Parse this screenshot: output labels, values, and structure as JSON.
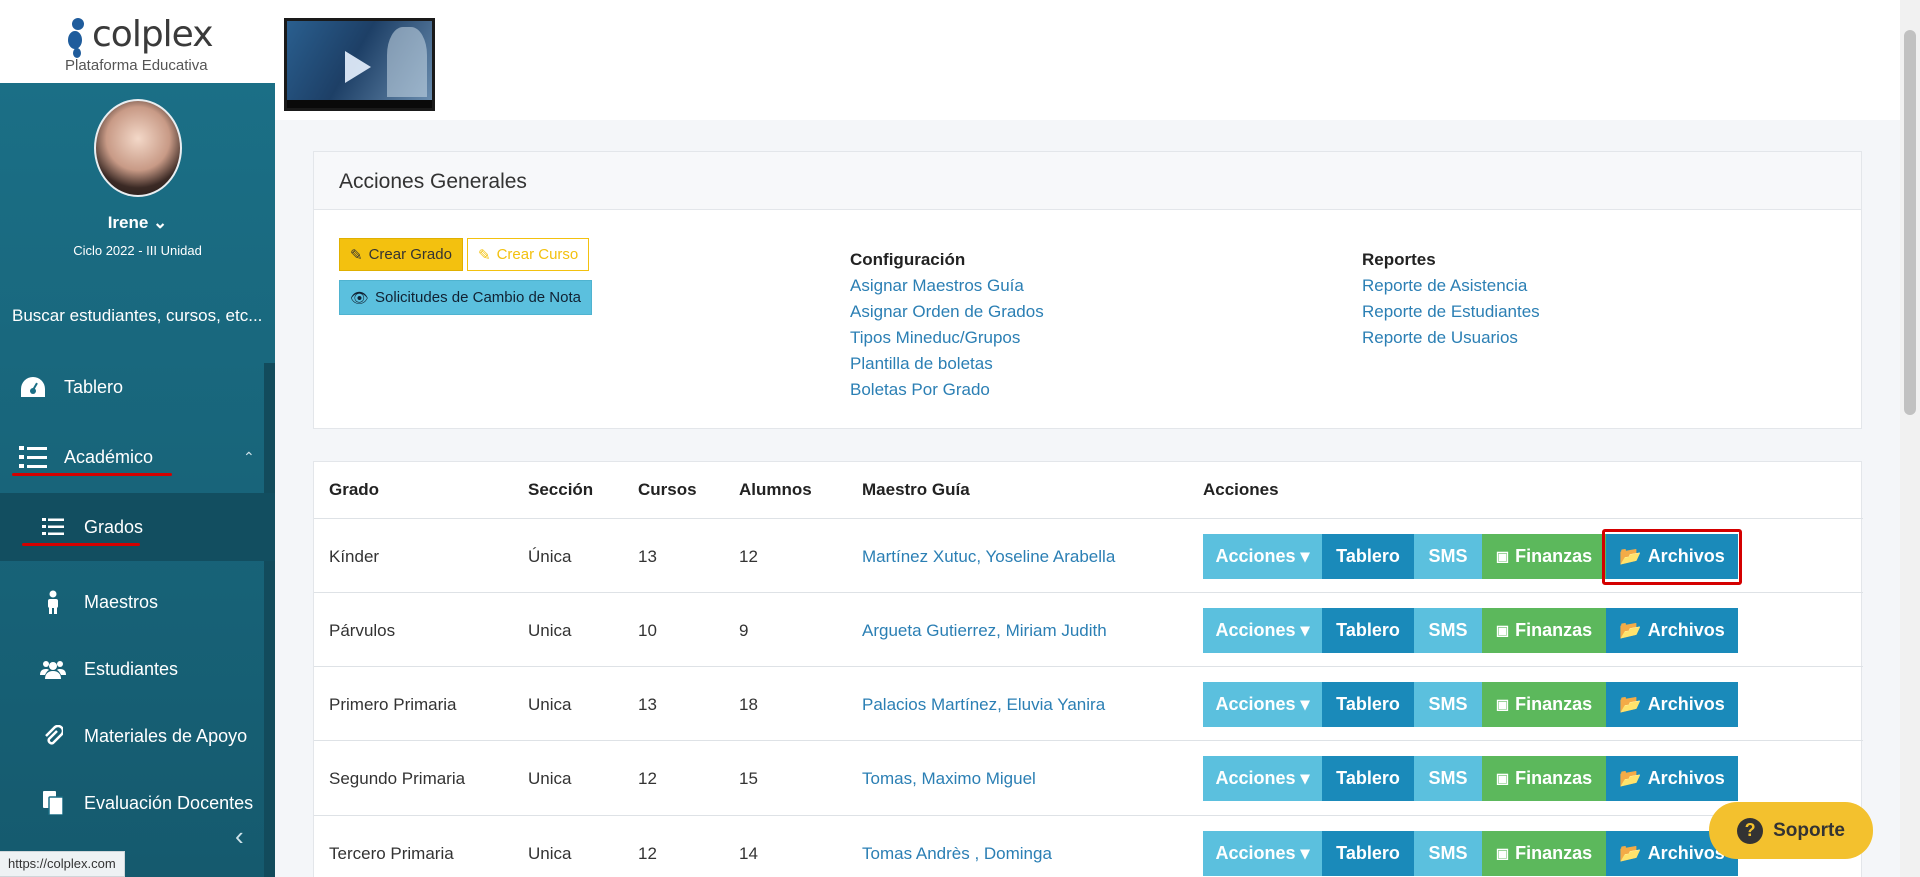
{
  "brand": {
    "logo_text": "colplex",
    "logo_sub": "Plataforma Educativa"
  },
  "user": {
    "name": "Irene ⌄",
    "cycle": "Ciclo 2022 - III Unidad"
  },
  "sidebar": {
    "search_hint": "Buscar estudiantes, cursos, etc...",
    "items": [
      {
        "label": "Tablero",
        "icon": "dashboard-icon"
      },
      {
        "label": "Académico",
        "icon": "list-icon"
      },
      {
        "label": "Grados",
        "icon": "list-icon"
      },
      {
        "label": "Maestros",
        "icon": "person-icon"
      },
      {
        "label": "Estudiantes",
        "icon": "users-icon"
      },
      {
        "label": "Materiales de Apoyo",
        "icon": "paperclip-icon"
      },
      {
        "label": "Evaluación Docentes",
        "icon": "copy-icon"
      }
    ],
    "collapse": "‹",
    "status_url": "https://colplex.com"
  },
  "acciones": {
    "title": "Acciones Generales",
    "crear_grado": "Crear Grado",
    "crear_curso": "Crear Curso",
    "solicitudes": "Solicitudes de Cambio de Nota",
    "config_title": "Configuración",
    "config_links": [
      "Asignar Maestros Guía",
      "Asignar Orden de Grados",
      "Tipos Mineduc/Grupos",
      "Plantilla de boletas",
      "Boletas Por Grado"
    ],
    "reports_title": "Reportes",
    "reports_links": [
      "Reporte de Asistencia",
      "Reporte de Estudiantes",
      "Reporte de Usuarios"
    ]
  },
  "table": {
    "headers": [
      "Grado",
      "Sección",
      "Cursos",
      "Alumnos",
      "Maestro Guía",
      "Acciones"
    ],
    "rows": [
      {
        "grado": "Kínder",
        "seccion": "Única",
        "cursos": "13",
        "alumnos": "12",
        "maestro": "Martínez Xutuc, Yoseline Arabella"
      },
      {
        "grado": "Párvulos",
        "seccion": "Unica",
        "cursos": "10",
        "alumnos": "9",
        "maestro": "Argueta Gutierrez, Miriam Judith"
      },
      {
        "grado": "Primero Primaria",
        "seccion": "Unica",
        "cursos": "13",
        "alumnos": "18",
        "maestro": "Palacios Martínez, Eluvia Yanira"
      },
      {
        "grado": "Segundo Primaria",
        "seccion": "Unica",
        "cursos": "12",
        "alumnos": "15",
        "maestro": "Tomas, Maximo Miguel"
      },
      {
        "grado": "Tercero Primaria",
        "seccion": "Unica",
        "cursos": "12",
        "alumnos": "14",
        "maestro": "Tomas Andrès , Dominga"
      }
    ],
    "actions": {
      "acciones": "Acciones ▾",
      "tablero": "Tablero",
      "sms": "SMS",
      "finanzas": "Finanzas",
      "archivos": "Archivos"
    }
  },
  "soporte": {
    "label": "Soporte",
    "q": "?"
  },
  "colors": {
    "sidebar": "#1b6f86",
    "accent_yellow": "#f3c10f",
    "info": "#5bc0de",
    "primary": "#1a8aba",
    "success": "#5cb85c",
    "highlight": "#d40000"
  }
}
